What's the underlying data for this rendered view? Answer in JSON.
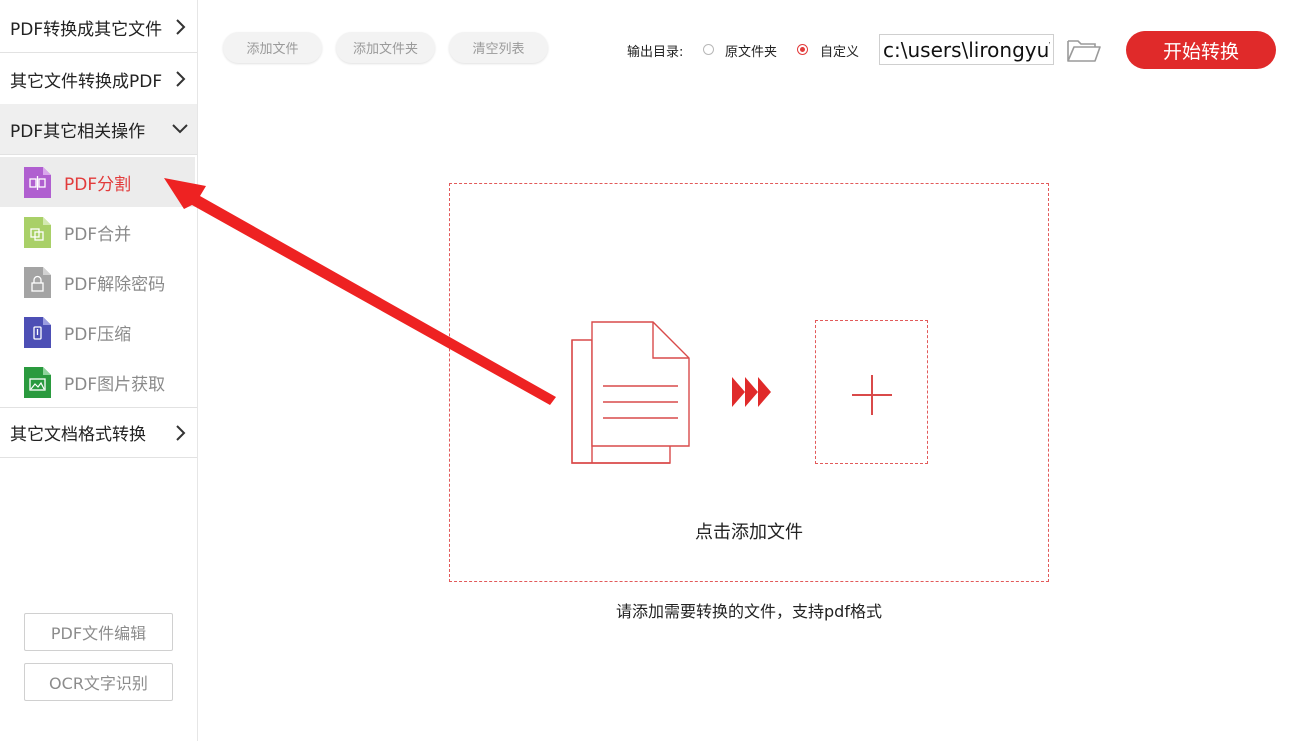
{
  "sidebar": {
    "categories": [
      {
        "label": "PDF转换成其它文件"
      },
      {
        "label": "其它文件转换成PDF"
      },
      {
        "label": "PDF其它相关操作"
      },
      {
        "label": "其它文档格式转换"
      }
    ],
    "sub_items": [
      {
        "label": "PDF分割",
        "icon": "split-file-icon",
        "color": "#b05fd0"
      },
      {
        "label": "PDF合并",
        "icon": "merge-file-icon",
        "color": "#a9d068"
      },
      {
        "label": "PDF解除密码",
        "icon": "unlock-file-icon",
        "color": "#a4a4a4"
      },
      {
        "label": "PDF压缩",
        "icon": "compress-file-icon",
        "color": "#4d4fb5"
      },
      {
        "label": "PDF图片获取",
        "icon": "image-file-icon",
        "color": "#2a9a3e"
      }
    ],
    "bottom_buttons": [
      {
        "label": "PDF文件编辑"
      },
      {
        "label": "OCR文字识别"
      }
    ]
  },
  "toolbar": {
    "add_file": "添加文件",
    "add_folder": "添加文件夹",
    "clear_list": "清空列表",
    "output_label": "输出目录:",
    "radio_original": "原文件夹",
    "radio_custom": "自定义",
    "output_path": "c:\\users\\lirongyu\\",
    "start_button": "开始转换"
  },
  "dropzone": {
    "click_text": "点击添加文件",
    "hint": "请添加需要转换的文件，支持pdf格式"
  },
  "colors": {
    "accent": "#e02a2a",
    "active_text": "#e23b3b",
    "dashed_border": "#e25a5a"
  }
}
